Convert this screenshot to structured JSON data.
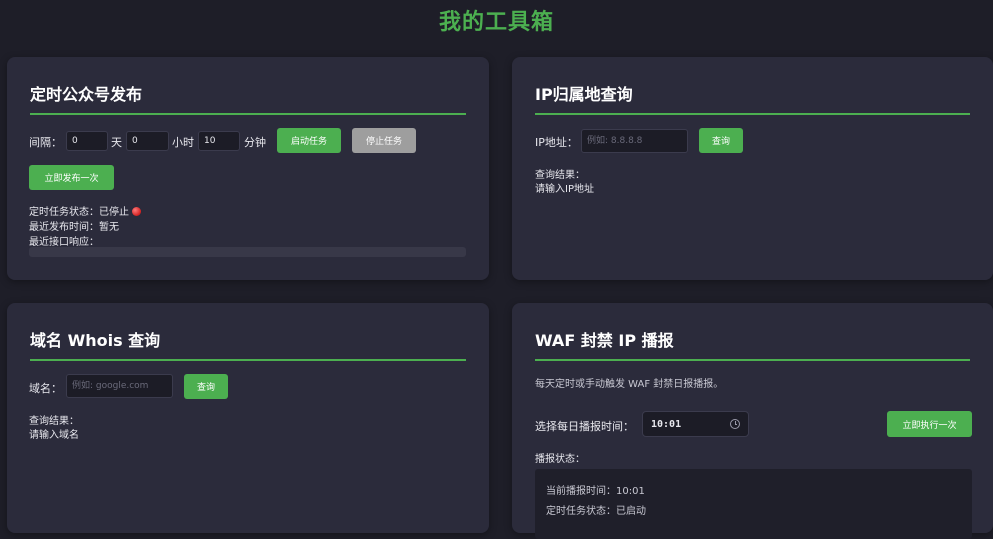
{
  "page_title": "我的工具箱",
  "colors": {
    "accent": "#4caf50",
    "stop_button": "#9e9e9e",
    "status_stopped": "#d32020"
  },
  "schedule": {
    "title": "定时公众号发布",
    "interval_label": "间隔：",
    "days_value": "0",
    "days_unit": "天",
    "hours_value": "0",
    "hours_unit": "小时",
    "minutes_value": "10",
    "minutes_unit": "分钟",
    "start_button": "启动任务",
    "stop_button": "停止任务",
    "publish_now_button": "立即发布一次",
    "status_label": "定时任务状态：",
    "status_value": "已停止",
    "last_publish_label": "最近发布时间：",
    "last_publish_value": "暂无",
    "last_response_label": "最近接口响应：",
    "status_icon": "red-dot-icon"
  },
  "ip_lookup": {
    "title": "IP归属地查询",
    "field_label": "IP地址：",
    "placeholder": "例如: 8.8.8.8",
    "query_button": "查询",
    "result_label": "查询结果：",
    "result_value": "请输入IP地址"
  },
  "whois": {
    "title": "域名 Whois 查询",
    "field_label": "域名：",
    "placeholder": "例如: google.com",
    "query_button": "查询",
    "result_label": "查询结果：",
    "result_value": "请输入域名"
  },
  "waf": {
    "title": "WAF 封禁 IP 播报",
    "description": "每天定时或手动触发 WAF 封禁日报播报。",
    "time_label": "选择每日播报时间：",
    "time_value": "10:01",
    "time_icon": "clock-icon",
    "run_now_button": "立即执行一次",
    "status_label": "播报状态：",
    "current_time_line": "当前播报时间：10:01",
    "task_status_line": "定时任务状态：已启动"
  }
}
